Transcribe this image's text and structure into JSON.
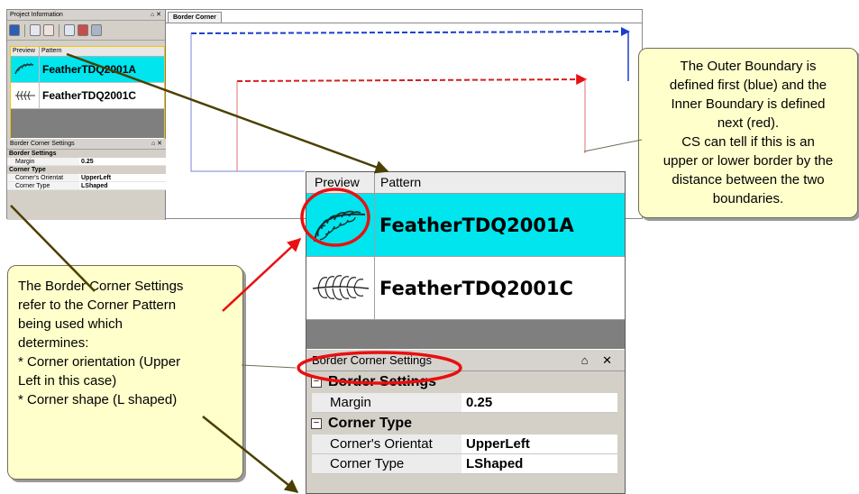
{
  "small_panel": {
    "project_info_title": "Project Information",
    "pin_close": "⌂ ✕",
    "list_headers": [
      "Preview",
      "Pattern"
    ],
    "patterns": [
      {
        "name": "FeatherTDQ2001A",
        "selected": true
      },
      {
        "name": "FeatherTDQ2001C",
        "selected": false
      }
    ],
    "bcs_title": "Border Corner Settings",
    "border_settings_label": "Border Settings",
    "margin_label": "Margin",
    "margin_value": "0.25",
    "corner_type_label": "Corner Type",
    "orientation_label": "Corner's Orientat",
    "orientation_value": "UpperLeft",
    "corner_type_prop_label": "Corner Type",
    "corner_type_value": "LShaped",
    "doc_tab": "Border Corner"
  },
  "zoom_panel": {
    "col_preview": "Preview",
    "col_pattern": "Pattern",
    "pattern_a": "FeatherTDQ2001A",
    "pattern_c": "FeatherTDQ2001C",
    "bcs_title": "Border Corner Settings",
    "title_controls": "⌂ ✕",
    "cat_border": "Border Settings",
    "margin_label": "Margin",
    "margin_value": "0.25",
    "cat_corner": "Corner Type",
    "orientation_label": "Corner's Orientat",
    "orientation_value": "UpperLeft",
    "corner_type_label": "Corner Type",
    "corner_type_value": "LShaped",
    "expand_glyph": "−"
  },
  "callouts": {
    "right": [
      "The Outer Boundary is",
      "defined first (blue) and the",
      "Inner Boundary is defined",
      "next (red).",
      "CS can tell if this is an",
      "upper or lower border by the",
      "distance between the two",
      "boundaries."
    ],
    "left": [
      "The Border Corner Settings",
      "refer to the Corner Pattern",
      "being used which",
      "determines:",
      "* Corner orientation (Upper",
      "Left in this case)",
      "* Corner shape (L shaped)"
    ]
  },
  "colors": {
    "selected_row": "#00e5ee",
    "outer_boundary": "#1a3fcf",
    "inner_boundary": "#d42020",
    "highlight_ellipse": "#e81010",
    "pointer_arrow": "#4a4000",
    "callout_fill": "#ffffcc"
  },
  "icons": [
    "save-icon",
    "open-icon",
    "delete-icon",
    "import-icon",
    "group-icon",
    "group-remove-icon",
    "feather-pattern-icon"
  ]
}
